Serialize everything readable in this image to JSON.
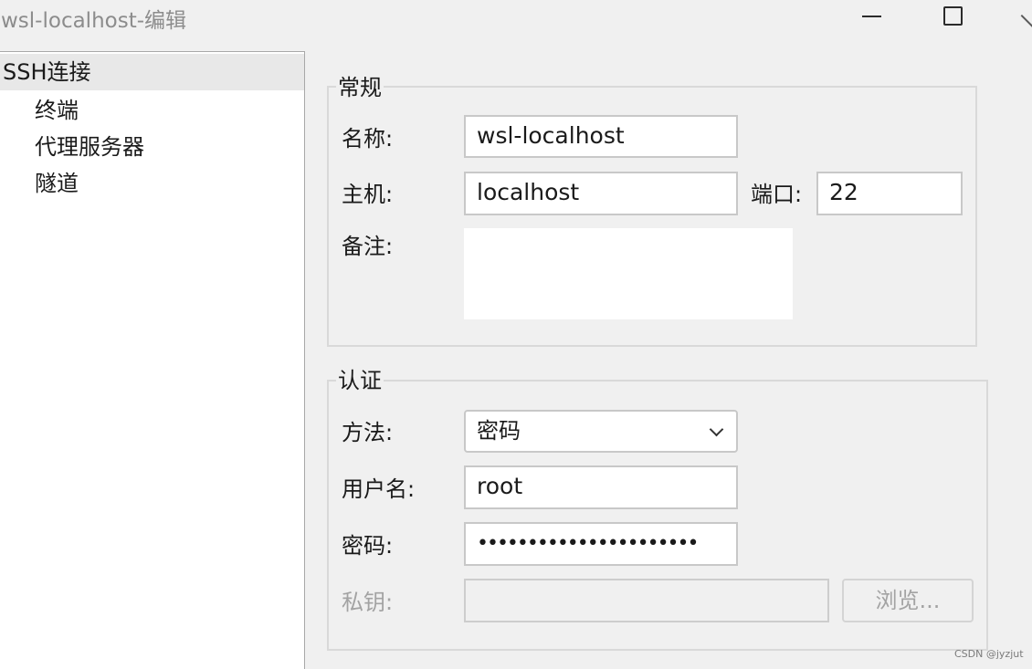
{
  "window": {
    "title": "wsl-localhost-编辑"
  },
  "sidebar": {
    "items": [
      {
        "label": "SSH连接",
        "selected": true
      },
      {
        "label": "终端"
      },
      {
        "label": "代理服务器"
      },
      {
        "label": "隧道"
      }
    ]
  },
  "general": {
    "title": "常规",
    "name_label": "名称:",
    "name_value": "wsl-localhost",
    "host_label": "主机:",
    "host_value": "localhost",
    "port_label": "端口:",
    "port_value": "22",
    "note_label": "备注:",
    "note_value": ""
  },
  "auth": {
    "title": "认证",
    "method_label": "方法:",
    "method_value": "密码",
    "username_label": "用户名:",
    "username_value": "root",
    "password_label": "密码:",
    "password_value": "••••••••••••••••••••••",
    "key_label": "私钥:",
    "key_value": "",
    "browse_label": "浏览..."
  },
  "watermark": "CSDN @jyzjut"
}
